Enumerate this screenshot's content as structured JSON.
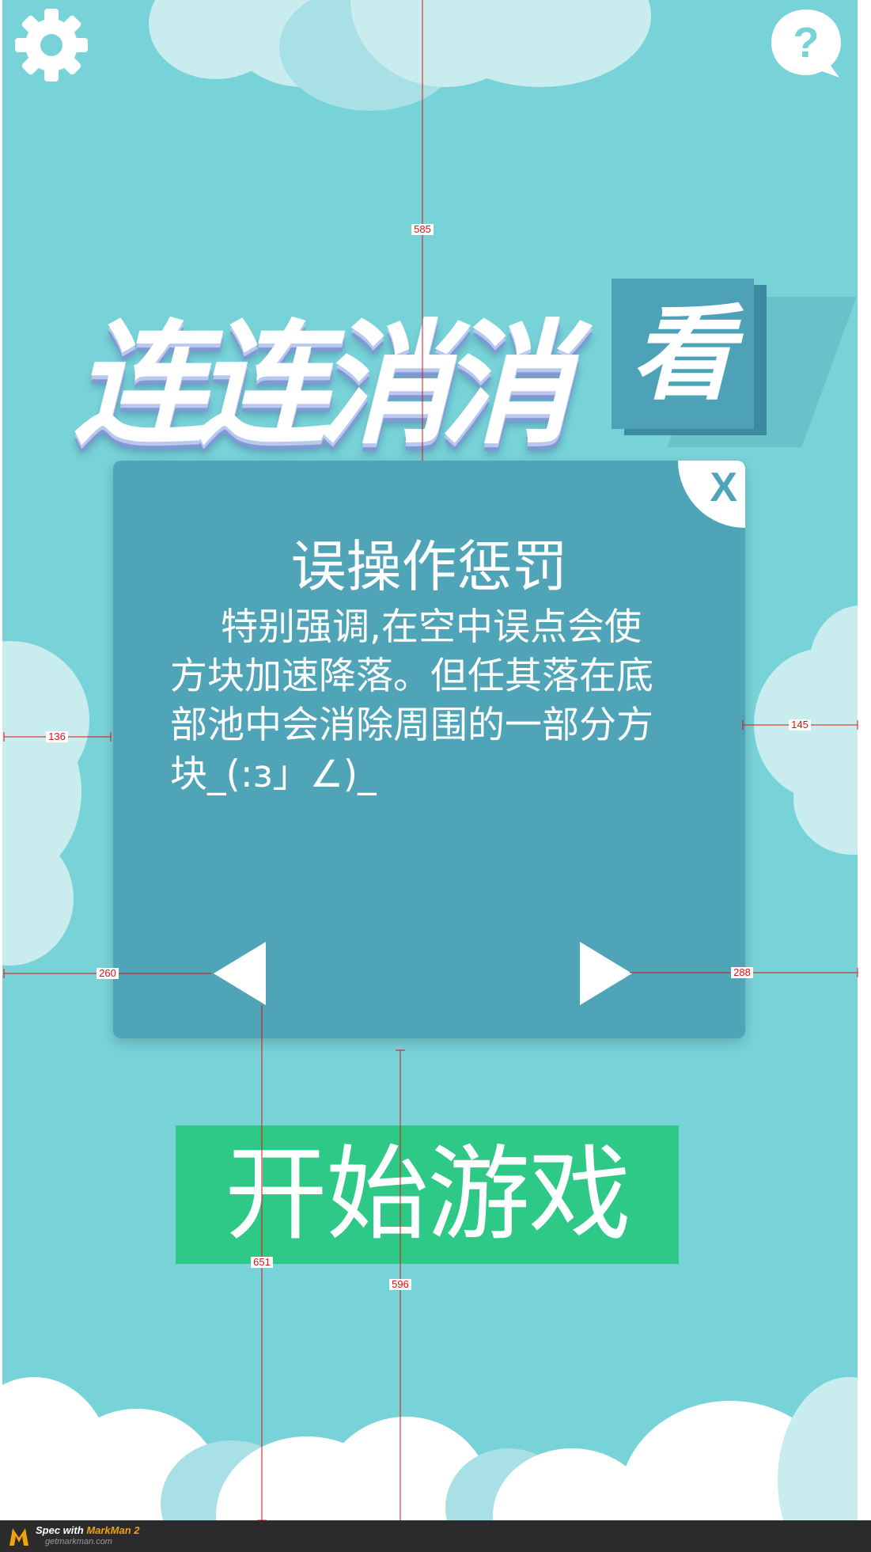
{
  "app": {
    "title_main": "连连消消",
    "title_box_char": "看"
  },
  "icons": {
    "settings": "gear-icon",
    "help": "question-icon"
  },
  "help_glyph": "?",
  "dialog": {
    "close_label": "X",
    "title": "误操作惩罚",
    "body": "特别强调,在空中误点会使方块加速降落。但任其落在底部池中会消除周围的一部分方块_(:з」∠)_"
  },
  "start_button": {
    "label": "开始游戏"
  },
  "spec_annotations": {
    "top_to_dialog": "585",
    "dialog_left_margin": "136",
    "dialog_right_margin": "145",
    "left_arrow_margin": "260",
    "right_arrow_margin": "288",
    "arrow_to_bottom": "651",
    "dialog_to_bottom": "596"
  },
  "footer": {
    "spec_with": "Spec with",
    "brand": "MarkMan 2",
    "site": "getmarkman.com"
  },
  "colors": {
    "background": "#78d3d8",
    "dialog": "#4fa4b8",
    "start_button": "#2ec987",
    "spec_line": "#dd1111"
  }
}
